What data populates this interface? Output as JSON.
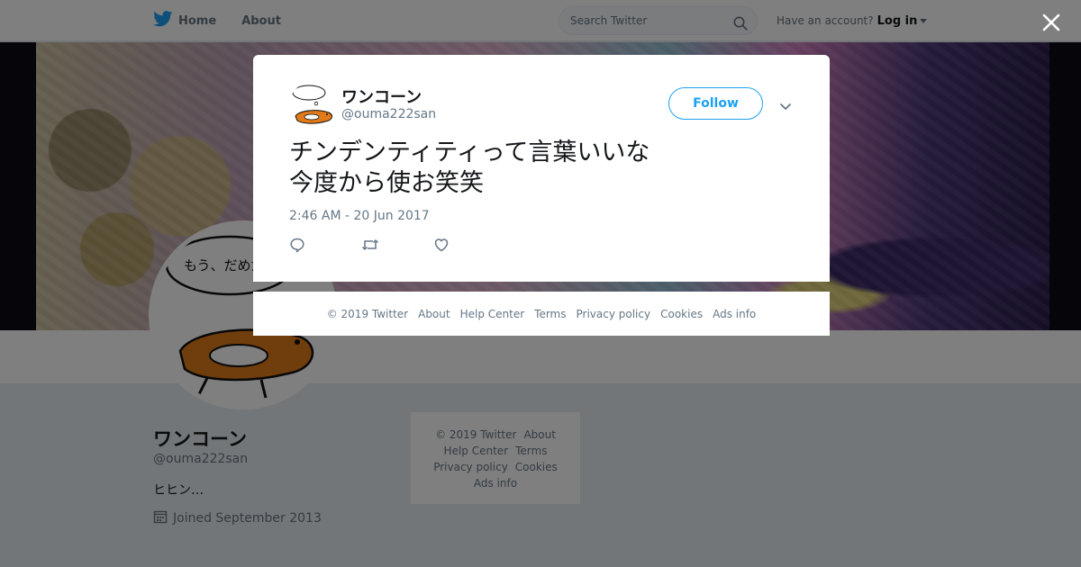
{
  "nav": {
    "home_label": "Home",
    "about_label": "About",
    "search_placeholder": "Search Twitter",
    "account_prompt": "Have an account?",
    "login_label": "Log in"
  },
  "profile": {
    "name": "ワンコーン",
    "handle": "@ouma222san",
    "bio": "ヒヒン…",
    "joined": "Joined September 2013",
    "avatar_speech": "もう、だめだ"
  },
  "side_footer": {
    "copyright": "© 2019 Twitter",
    "about": "About",
    "help": "Help Center",
    "terms": "Terms",
    "privacy": "Privacy policy",
    "cookies": "Cookies",
    "ads": "Ads info"
  },
  "tweet": {
    "name": "ワンコーン",
    "handle": "@ouma222san",
    "follow_label": "Follow",
    "text": "チンデンティティって言葉いいな\n今度から使お笑笑",
    "timestamp": "2:46 AM - 20 Jun 2017"
  },
  "modal_footer": {
    "copyright": "© 2019 Twitter",
    "about": "About",
    "help": "Help Center",
    "terms": "Terms",
    "privacy": "Privacy policy",
    "cookies": "Cookies",
    "ads": "Ads info"
  },
  "colors": {
    "brand_blue": "#1da1f2",
    "secondary_text": "#657786",
    "overlay": "rgba(0,0,0,0.5)"
  },
  "icons": {
    "logo": "twitter-bird-icon",
    "search": "search-icon",
    "close": "close-icon",
    "more": "chevron-down-icon",
    "reply": "reply-icon",
    "retweet": "retweet-icon",
    "like": "heart-icon",
    "calendar": "calendar-icon"
  }
}
